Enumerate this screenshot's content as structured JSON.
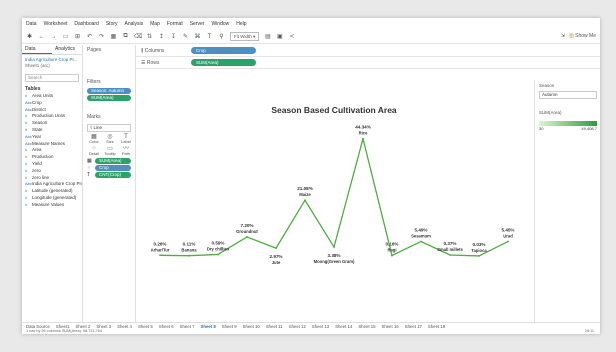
{
  "menu": [
    "Data",
    "Worksheet",
    "Dashboard",
    "Story",
    "Analysis",
    "Map",
    "Format",
    "Server",
    "Window",
    "Help"
  ],
  "toolbar": {
    "fit_label": "Fit Width",
    "show_me_label": "Show Me"
  },
  "data_pane": {
    "tabs": [
      "Data",
      "Analytics"
    ],
    "sources": [
      "India Agriculture Crop Pr...",
      "Sheet1 (arc)"
    ],
    "search_placeholder": "Search",
    "tables_heading": "Tables",
    "fields": [
      "Area Units",
      "Crop",
      "District",
      "Production Units",
      "Season",
      "State",
      "Year",
      "Measure Names",
      "Area",
      "Production",
      "Yield",
      "zero",
      "zero line",
      "India Agriculture Crop Pro...",
      "Latitude (generated)",
      "Longitude (generated)",
      "Measure Values"
    ]
  },
  "pages_title": "Pages",
  "filters": {
    "title": "Filters",
    "pills": [
      "Season: Autumn",
      "SUM(Area)"
    ]
  },
  "marks": {
    "title": "Marks",
    "type": "Line",
    "buttons": [
      {
        "icon": "color-icon",
        "label": "Color"
      },
      {
        "icon": "size-icon",
        "label": "Size"
      },
      {
        "icon": "label-icon",
        "label": "Label"
      },
      {
        "icon": "detail-icon",
        "label": "Detail"
      },
      {
        "icon": "tooltip-icon",
        "label": "Tooltip"
      },
      {
        "icon": "path-icon",
        "label": "Path"
      }
    ],
    "pills": [
      "SUM(Area)",
      "Crop",
      "CNT(Crop)"
    ]
  },
  "shelves": {
    "columns_label": "Columns",
    "columns_pill": "Crop",
    "rows_label": "Rows",
    "rows_pill": "SUM(Area)"
  },
  "legend": {
    "title": "Season",
    "selected": "Autumn",
    "measure_title": "SUM(Area)",
    "min": "30",
    "max": "49,408.7"
  },
  "tabs": [
    "Data Source",
    "Sheet1",
    "Sheet 2",
    "Sheet 3",
    "Sheet 4",
    "Sheet 5",
    "Sheet 6",
    "Sheet 7",
    "Sheet 8",
    "Sheet 9",
    "Sheet 10",
    "Sheet 11",
    "Sheet 12",
    "Sheet 13",
    "Sheet 14",
    "Sheet 15",
    "Sheet 16",
    "Sheet 17",
    "Sheet 18"
  ],
  "active_tab": "Sheet 8",
  "status": {
    "left": "1 row by 26 columns  SUM(Area): 98,721,764",
    "right": "29:11"
  },
  "colors": {
    "accent": "#1f77b4",
    "line": "#4caf3e",
    "pill_blue": "#4e8fc1",
    "pill_green": "#2aa36b"
  },
  "chart_data": {
    "type": "line",
    "title": "Season Based Cultivation Area",
    "categories": [
      "Arhar/Tur",
      "Banana",
      "Dry chillies",
      "Groundnut",
      "Jute",
      "Maize",
      "Moong(Green Gram)",
      "Rice",
      "Ragi",
      "Sesamum",
      "Small millets",
      "Tapioca",
      "Urad"
    ],
    "values": [
      0.26,
      0.11,
      0.59,
      7.2,
      2.97,
      21.08,
      3.38,
      44.34,
      0.16,
      5.49,
      0.37,
      0.03,
      5.45
    ],
    "labels": [
      "0.26%",
      "0.11%",
      "0.59%",
      "7.20%",
      "2.97%",
      "21.08%",
      "3.38%",
      "44.34%",
      "0.16%",
      "5.49%",
      "0.37%",
      "0.03%",
      "5.45%"
    ],
    "ylim": [
      0,
      48
    ]
  }
}
